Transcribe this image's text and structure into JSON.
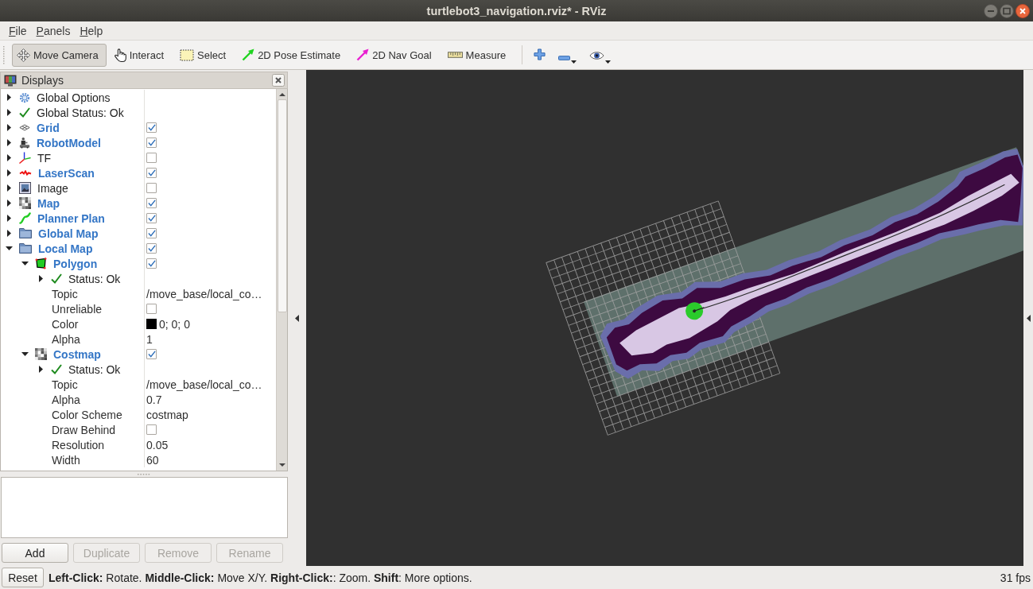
{
  "window": {
    "title": "turtlebot3_navigation.rviz* - RViz"
  },
  "menu": [
    {
      "label": "File"
    },
    {
      "label": "Panels"
    },
    {
      "label": "Help"
    }
  ],
  "toolbar": {
    "tools": [
      {
        "label": "Move Camera",
        "kind": "move",
        "selected": true
      },
      {
        "label": "Interact",
        "kind": "interact",
        "selected": false
      },
      {
        "label": "Select",
        "kind": "select",
        "selected": false
      },
      {
        "label": "2D Pose Estimate",
        "kind": "pose",
        "selected": false
      },
      {
        "label": "2D Nav Goal",
        "kind": "goal",
        "selected": false
      },
      {
        "label": "Measure",
        "kind": "measure",
        "selected": false
      }
    ],
    "view_buttons": [
      {
        "kind": "add",
        "has_menu": false
      },
      {
        "kind": "remove",
        "has_menu": true
      },
      {
        "kind": "view",
        "has_menu": true
      }
    ]
  },
  "displays": {
    "title": "Displays",
    "items": [
      {
        "label": "Global Options",
        "kind": "options",
        "expanded": false
      },
      {
        "label": "Global Status: Ok",
        "kind": "status",
        "expanded": false
      },
      {
        "label": "Grid",
        "kind": "grid",
        "expanded": false,
        "checked": true
      },
      {
        "label": "RobotModel",
        "kind": "robot",
        "expanded": false,
        "checked": true
      },
      {
        "label": "TF",
        "kind": "tf",
        "expanded": false,
        "checked": false
      },
      {
        "label": "LaserScan",
        "kind": "laser",
        "expanded": false,
        "checked": true
      },
      {
        "label": "Image",
        "kind": "image",
        "expanded": false,
        "checked": false
      },
      {
        "label": "Map",
        "kind": "map",
        "expanded": false,
        "checked": true
      },
      {
        "label": "Planner Plan",
        "kind": "path",
        "expanded": false,
        "checked": true
      },
      {
        "label": "Global Map",
        "kind": "folder",
        "expanded": false,
        "checked": true
      },
      {
        "label": "Local Map",
        "kind": "folder",
        "expanded": true,
        "checked": true,
        "children": [
          {
            "label": "Polygon",
            "kind": "polygon",
            "expanded": true,
            "checked": true,
            "children": [
              {
                "label": "Status: Ok",
                "kind": "status",
                "expanded": false
              },
              {
                "label": "Topic",
                "kind": "text",
                "value": "/move_base/local_co…"
              },
              {
                "label": "Unreliable",
                "kind": "bool",
                "checked": false
              },
              {
                "label": "Color",
                "kind": "color",
                "value": "0; 0; 0",
                "color": "#000000"
              },
              {
                "label": "Alpha",
                "kind": "text",
                "value": "1"
              }
            ]
          },
          {
            "label": "Costmap",
            "kind": "map",
            "expanded": true,
            "checked": true,
            "children": [
              {
                "label": "Status: Ok",
                "kind": "status",
                "expanded": false
              },
              {
                "label": "Topic",
                "kind": "text",
                "value": "/move_base/local_co…"
              },
              {
                "label": "Alpha",
                "kind": "text",
                "value": "0.7"
              },
              {
                "label": "Color Scheme",
                "kind": "text",
                "value": "costmap"
              },
              {
                "label": "Draw Behind",
                "kind": "bool",
                "checked": false
              },
              {
                "label": "Resolution",
                "kind": "text",
                "value": "0.05"
              },
              {
                "label": "Width",
                "kind": "text",
                "value": "60"
              }
            ]
          }
        ]
      }
    ]
  },
  "panel_buttons": [
    {
      "label": "Add",
      "disabled": false
    },
    {
      "label": "Duplicate",
      "disabled": true
    },
    {
      "label": "Remove",
      "disabled": true
    },
    {
      "label": "Rename",
      "disabled": true
    }
  ],
  "status_bar": {
    "button": "Reset",
    "hint": "**Left-Click:** Rotate. **Middle-Click:** Move X/Y. **Right-Click:**: Zoom. **Shift**: More options.",
    "fps": "31 fps"
  }
}
